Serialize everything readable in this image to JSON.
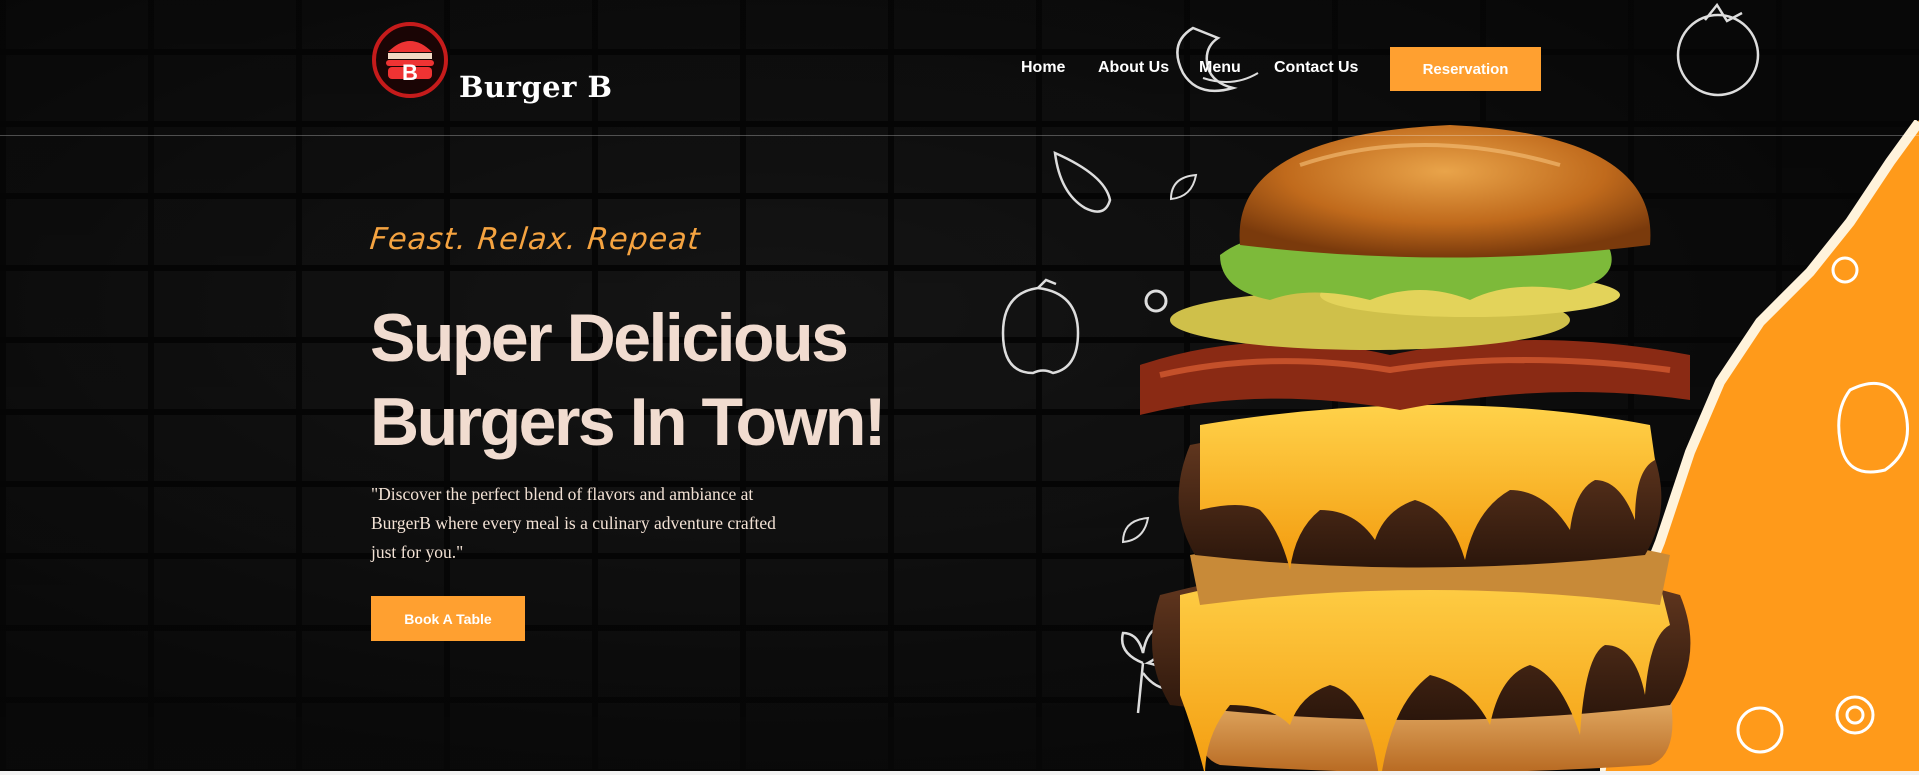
{
  "brand": {
    "name": "Burger B",
    "logo_letter": "B"
  },
  "nav": {
    "items": [
      "Home",
      "About Us",
      "Menu",
      "Contact Us"
    ],
    "reservation_label": "Reservation"
  },
  "hero": {
    "tagline": "Feast. Relax. Repeat",
    "headline_line1": "Super Delicious",
    "headline_line2": "Burgers In Town!",
    "description": "\"Discover the perfect blend of flavors and ambiance at BurgerB where every meal is a culinary adventure crafted just for you.\"",
    "cta_label": "Book A Table"
  },
  "colors": {
    "accent": "#ffa030",
    "headline": "#f1dcd0",
    "background": "#161616"
  },
  "icons": [
    "burger-logo-icon",
    "shrimp-doodle-icon",
    "tomato-doodle-icon",
    "garlic-doodle-icon",
    "leaf-doodle-icon",
    "pepper-doodle-icon",
    "parsley-doodle-icon",
    "burger-image"
  ]
}
